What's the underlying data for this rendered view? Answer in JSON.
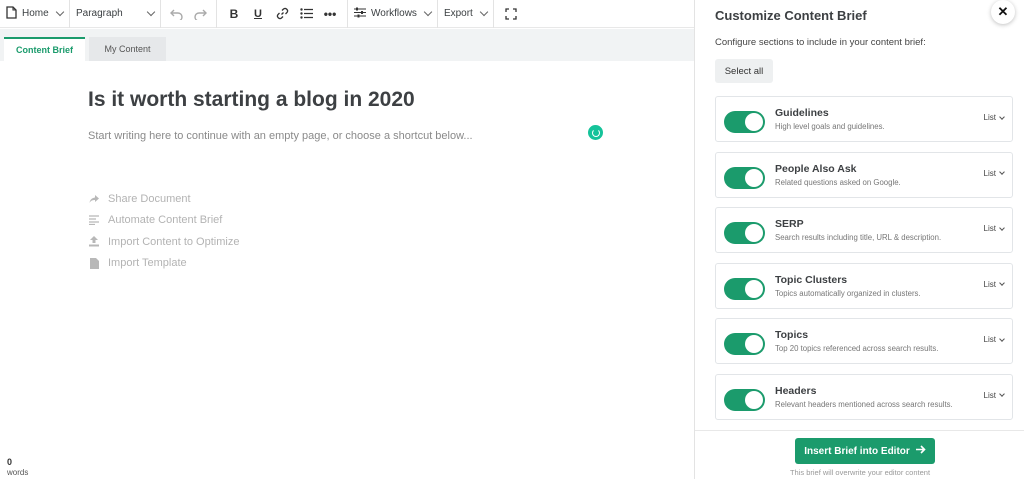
{
  "toolbar": {
    "home_label": "Home",
    "paragraph_label": "Paragraph",
    "workflows_label": "Workflows",
    "export_label": "Export"
  },
  "tabs": [
    {
      "label": "Content Brief",
      "active": true
    },
    {
      "label": "My Content",
      "active": false
    }
  ],
  "editor": {
    "title": "Is it worth starting a blog in 2020",
    "placeholder": "Start writing here to continue with an empty page, or choose a shortcut below...",
    "shortcuts": [
      {
        "label": "Share Document",
        "icon": "share-icon"
      },
      {
        "label": "Automate Content Brief",
        "icon": "lines-icon"
      },
      {
        "label": "Import Content to Optimize",
        "icon": "upload-icon"
      },
      {
        "label": "Import Template",
        "icon": "document-icon"
      }
    ],
    "word_count": "0",
    "word_label": "words"
  },
  "panel": {
    "title": "Customize Content Brief",
    "close_label": "✕",
    "subtitle": "Configure sections to include in your content brief:",
    "select_all_label": "Select all",
    "sections": [
      {
        "title": "Guidelines",
        "desc": "High level goals and guidelines.",
        "mode": "List",
        "enabled": true
      },
      {
        "title": "People Also Ask",
        "desc": "Related questions asked on Google.",
        "mode": "List",
        "enabled": true
      },
      {
        "title": "SERP",
        "desc": "Search results including title, URL & description.",
        "mode": "List",
        "enabled": true
      },
      {
        "title": "Topic Clusters",
        "desc": "Topics automatically organized in clusters.",
        "mode": "List",
        "enabled": true
      },
      {
        "title": "Topics",
        "desc": "Top 20 topics referenced across search results.",
        "mode": "List",
        "enabled": true
      },
      {
        "title": "Headers",
        "desc": "Relevant headers mentioned across search results.",
        "mode": "List",
        "enabled": true
      }
    ],
    "insert_label": "Insert Brief into Editor",
    "footer_note": "This brief will overwrite your editor content"
  },
  "colors": {
    "accent": "#1b9b6c",
    "grammarly": "#15c39a"
  }
}
